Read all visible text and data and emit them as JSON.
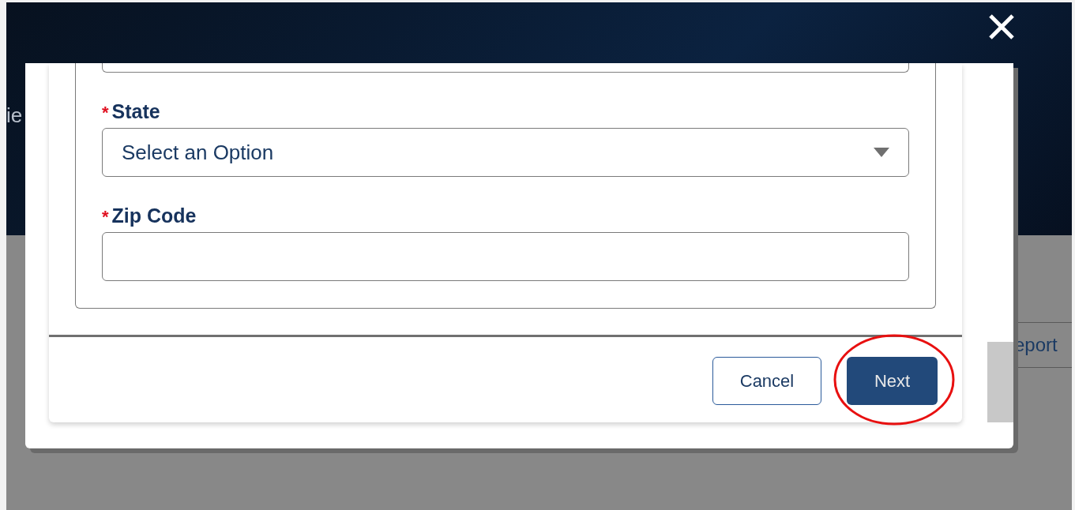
{
  "background": {
    "texts": [
      "ie",
      "eport"
    ]
  },
  "form": {
    "fields": [
      {
        "kind": "input"
      },
      {
        "kind": "select",
        "label": "State",
        "required_mark": "*",
        "placeholder": "Select an Option"
      },
      {
        "kind": "input",
        "label": "Zip Code",
        "required_mark": "*"
      }
    ]
  },
  "buttons": [
    {
      "label": "Cancel",
      "kind": "secondary",
      "highlighted": false
    },
    {
      "label": "Next",
      "kind": "primary",
      "highlighted": true
    }
  ]
}
